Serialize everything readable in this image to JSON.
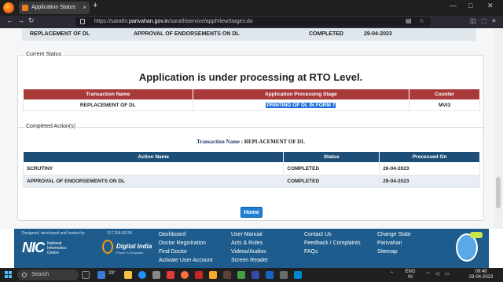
{
  "browser": {
    "tab_title": "Application Status",
    "tab_close": "×",
    "new_tab": "+",
    "url_prefix": "https://sarathi.",
    "url_host": "parivahan.gov.in",
    "url_path": "/sarathiservice/applViewStages.do",
    "window_controls": [
      "—",
      "□",
      "✕"
    ]
  },
  "top_row": {
    "transaction": "REPLACEMENT OF DL",
    "action": "APPROVAL OF ENDORSEMENTS ON DL",
    "status": "COMPLETED",
    "date": "29-04-2023"
  },
  "current_status": {
    "section_title": "Current Status",
    "headline": "Application is under processing at RTO Level.",
    "headers": [
      "Transaction Name",
      "Application Processing Stage",
      "Counter"
    ],
    "row": {
      "transaction": "REPLACEMENT OF DL",
      "stage": "PRINTING OF DL IN FORM 7",
      "counter": "MVI3"
    }
  },
  "completed_actions": {
    "section_title": "Completed Action(s)",
    "txn_label": "Transaction Name :",
    "txn_value": "REPLACEMENT OF DL",
    "headers": [
      "Action Name",
      "Status",
      "Processed On"
    ],
    "rows": [
      {
        "action": "SCRUTINY",
        "status": "COMPLETED",
        "date": "26-04-2023"
      },
      {
        "action": "APPROVAL OF ENDORSEMENTS ON DL",
        "status": "COMPLETED",
        "date": "29-04-2023"
      }
    ]
  },
  "home_button": "Home",
  "footer": {
    "developed_by": "Designed, developed and hosted by",
    "ip": "117.204.60.28",
    "nic_logo": "NIC",
    "nic_lines": [
      "National",
      "Informatics",
      "Centre"
    ],
    "digital_india": "Digital India",
    "digital_india_sub": "Power To Empower",
    "col1": [
      "Dashboard",
      "Doctor Registration",
      "Find Doctor",
      "Activate User Account"
    ],
    "col2": [
      "User Manual",
      "Acts & Rules",
      "Videos/Audios",
      "Screen Reader"
    ],
    "col3": [
      "Contact Us",
      "Feedback / Complaints",
      "FAQs"
    ],
    "col4": [
      "Change State",
      "Parivahan",
      "Sitemap"
    ]
  },
  "taskbar": {
    "search_placeholder": "Search",
    "temperature": "29°",
    "language": [
      "ENG",
      "IN"
    ],
    "time": "09:48",
    "date": "29-04-2023"
  },
  "colors": {
    "red_header": "#a93a3a",
    "blue_header": "#1d4e77",
    "footer_bg": "#1d5c8c",
    "selection": "#1e6fd9"
  }
}
